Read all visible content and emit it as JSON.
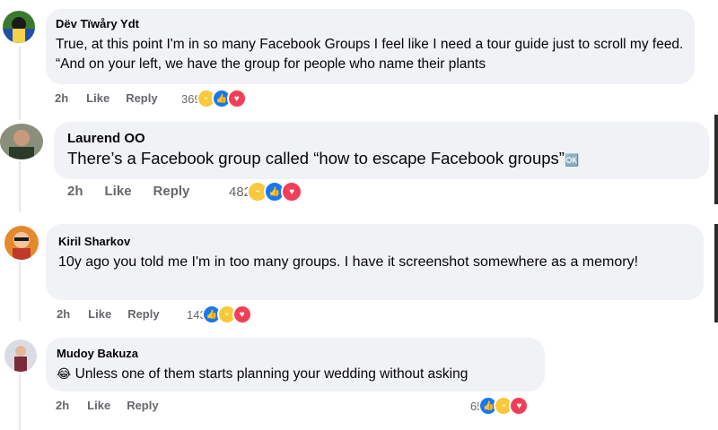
{
  "comments": [
    {
      "author": "Dëv Tïwåry Ydt",
      "text": "True, at this point I'm in so many Facebook Groups I feel like I need a tour guide just to scroll my feed. “And on your left, we have the group for people who name their plants",
      "time": "2h",
      "like_label": "Like",
      "reply_label": "Reply",
      "reaction_count": "369",
      "reactions": [
        "haha-icon",
        "like-icon",
        "love-icon"
      ]
    },
    {
      "author": "Laurend OO",
      "text": "There’s a Facebook group called “how to escape Facebook groups”",
      "text_suffix": "🆗",
      "time": "2h",
      "like_label": "Like",
      "reply_label": "Reply",
      "reaction_count": "482",
      "reactions": [
        "haha-icon",
        "like-icon",
        "love-icon"
      ]
    },
    {
      "author": "Kiril Sharkov",
      "text": "10y ago you told me I'm in too many groups. I have it screenshot somewhere as a memory!",
      "time": "2h",
      "like_label": "Like",
      "reply_label": "Reply",
      "reaction_count": "143",
      "reactions": [
        "like-icon",
        "haha-icon",
        "love-icon"
      ]
    },
    {
      "author": "Mudoy Bakuza",
      "text": "Unless one of them starts planning your wedding without asking",
      "emoji_prefix": "😂",
      "time": "2h",
      "like_label": "Like",
      "reply_label": "Reply",
      "reaction_count": "65",
      "reactions": [
        "like-icon",
        "haha-icon",
        "love-icon"
      ]
    }
  ],
  "colors": {
    "bubble": "#f0f2f5",
    "meta_text": "#65676b",
    "like_blue": "#1877f2",
    "love_red": "#f33e58",
    "haha_yellow": "#f7c93b"
  }
}
